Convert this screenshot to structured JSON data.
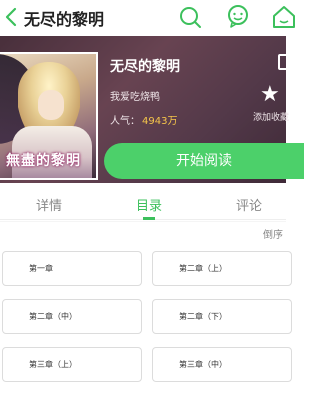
{
  "topbar": {
    "title": "无尽的黎明",
    "back_icon": "chevron-left-icon",
    "icons": [
      "search-icon",
      "chat-icon",
      "home-icon"
    ],
    "accent_color": "#3cc05c"
  },
  "book": {
    "name": "无尽的黎明",
    "author": "我爱吃烧鸭",
    "popularity_label": "人气：",
    "popularity_value": "4943万",
    "cover_title": "無盡的黎明",
    "favorite_label": "添加收藏",
    "read_button": "开始阅读"
  },
  "tabs": [
    {
      "label": "详情",
      "active": false
    },
    {
      "label": "目录",
      "active": true
    },
    {
      "label": "评论",
      "active": false
    }
  ],
  "sort_label": "倒序",
  "chapters": [
    "第一章",
    "第二章（上）",
    "第二章（中）",
    "第二章（下）",
    "第三章（上）",
    "第三章（中）"
  ],
  "colors": {
    "primary_green": "#4cd06a",
    "popularity_number": "#f6c64a"
  }
}
